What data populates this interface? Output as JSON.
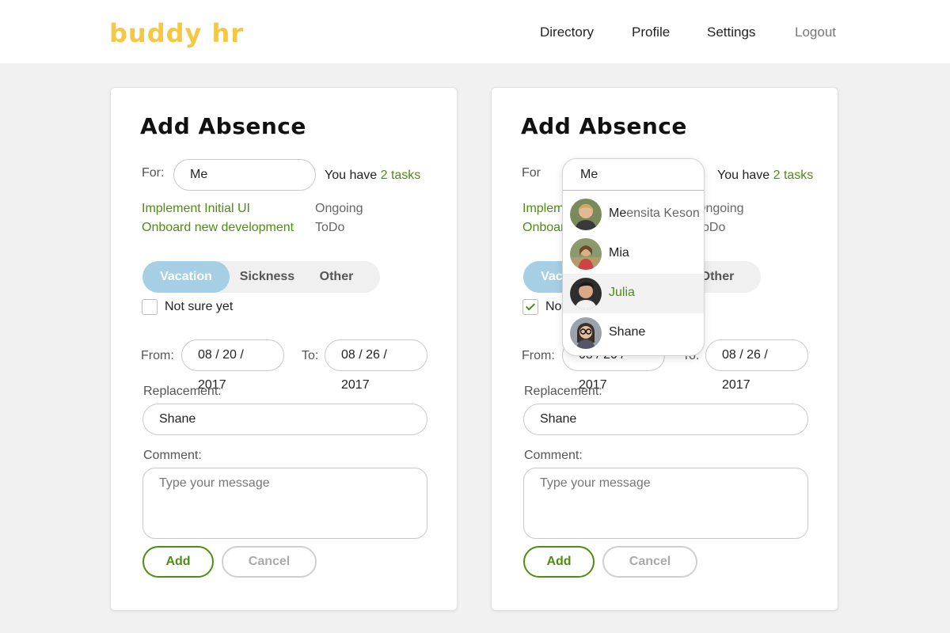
{
  "header": {
    "logo": "buddy hr",
    "nav": [
      "Directory",
      "Profile",
      "Settings",
      "Logout"
    ]
  },
  "form": {
    "title": "Add Absence",
    "for_label": "For:",
    "for_label_alt": "For",
    "for_value": "Me",
    "tasks_prefix": "You have",
    "tasks_link": "2 tasks",
    "tasks": [
      {
        "name": "Implement Initial UI",
        "status": "Ongoing"
      },
      {
        "name": "Onboard new development",
        "status": "ToDo"
      }
    ],
    "segments": [
      "Vacation",
      "Sickness",
      "Other"
    ],
    "not_sure_label": "Not sure yet",
    "from_label": "From:",
    "from_value": "08 / 20 / 2017",
    "to_label": "To:",
    "to_value": "08 / 26 / 2017",
    "replacement_label": "Replacement:",
    "replacement_value": "Shane",
    "comment_label": "Comment:",
    "comment_placeholder": "Type your message",
    "add_label": "Add",
    "cancel_label": "Cancel"
  },
  "dropdown": {
    "query": "Me",
    "items": [
      {
        "match": "Me",
        "rest": "ensita Keson",
        "avatar": "avatar-man-blond"
      },
      {
        "match": "",
        "rest": "Mia",
        "avatar": "avatar-woman-outdoor"
      },
      {
        "match": "",
        "rest": "Julia",
        "avatar": "avatar-man-dark",
        "highlighted": true
      },
      {
        "match": "",
        "rest": "Shane",
        "avatar": "avatar-woman-glasses"
      }
    ]
  },
  "colors": {
    "logo": "#f5c842",
    "accent_green": "#4e8d12",
    "segment_active": "#a6cfe5"
  }
}
